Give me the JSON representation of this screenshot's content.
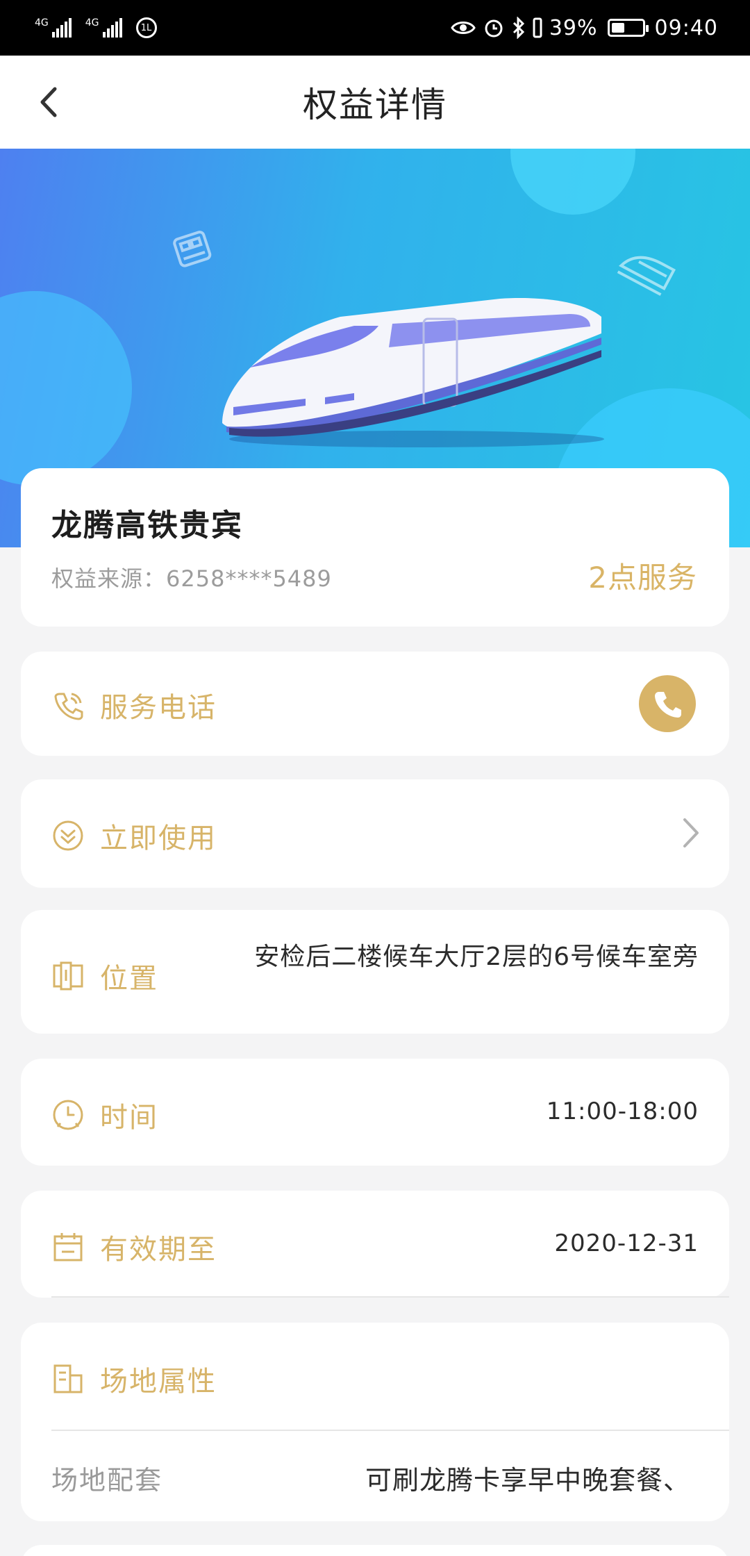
{
  "status_bar": {
    "network_1": "4G",
    "network_2": "4G",
    "hd_badge": "1L",
    "battery": "39%",
    "time": "09:40"
  },
  "header": {
    "title": "权益详情"
  },
  "benefit": {
    "name": "龙腾高铁贵宾",
    "source": "权益来源：6258****5489",
    "points": "2点服务"
  },
  "service_phone": {
    "label": "服务电话"
  },
  "use_now": {
    "label": "立即使用"
  },
  "location": {
    "label": "位置",
    "value": "安检后二楼候车大厅2层的6号候车室旁"
  },
  "hours": {
    "label": "时间",
    "value": "11:00-18:00"
  },
  "validity": {
    "label": "有效期至",
    "value": "2020-12-31"
  },
  "venue": {
    "label": "场地属性",
    "facilities_label": "场地配套",
    "facilities_value": "可刷龙腾卡享早中晚套餐、"
  },
  "colors": {
    "accent_gold": "#d7b469",
    "banner_start": "#4e80f0",
    "banner_end": "#27c5e3"
  }
}
